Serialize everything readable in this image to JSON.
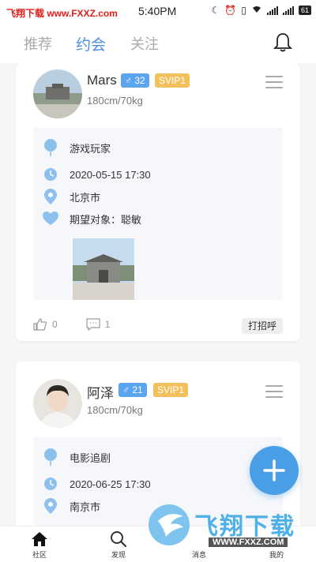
{
  "watermark": {
    "top_text": "飞翔下载 www.FXXZ.com",
    "brand_text": "飞翔下载",
    "brand_url": "WWW.FXXZ.COM"
  },
  "status_bar": {
    "time": "5:40PM",
    "battery": "61",
    "icons": [
      "moon-icon",
      "alarm-icon",
      "vibrate-icon",
      "wifi-icon",
      "signal-icon",
      "battery-icon"
    ]
  },
  "top_nav": {
    "tabs": [
      {
        "label": "推荐",
        "active": false
      },
      {
        "label": "约会",
        "active": true
      },
      {
        "label": "关注",
        "active": false
      }
    ],
    "bell_icon": "bell-icon"
  },
  "posts": [
    {
      "name": "Mars",
      "gender_symbol": "♂",
      "age": "32",
      "vip": "SVIP1",
      "body": "180cm/70kg",
      "activity": "游戏玩家",
      "datetime": "2020-05-15 17:30",
      "city": "北京市",
      "expectation": "期望对象：聪敏",
      "likes": "0",
      "comments": "1",
      "greet_label": "打招呼"
    },
    {
      "name": "阿泽",
      "gender_symbol": "♂",
      "age": "21",
      "vip": "SVIP1",
      "body": "180cm/70kg",
      "activity": "电影追剧",
      "datetime": "2020-06-25 17:30",
      "city": "南京市"
    }
  ],
  "bottom_nav": [
    {
      "label": "社区",
      "icon": "home-icon"
    },
    {
      "label": "发现",
      "icon": "search-icon"
    },
    {
      "label": "消息",
      "icon": "message-icon"
    },
    {
      "label": "我的",
      "icon": "profile-icon"
    }
  ],
  "colors": {
    "accent": "#4a90e2",
    "vip": "#f2c15c",
    "age_badge": "#5ba4f0",
    "fab": "#4a9ee6"
  }
}
